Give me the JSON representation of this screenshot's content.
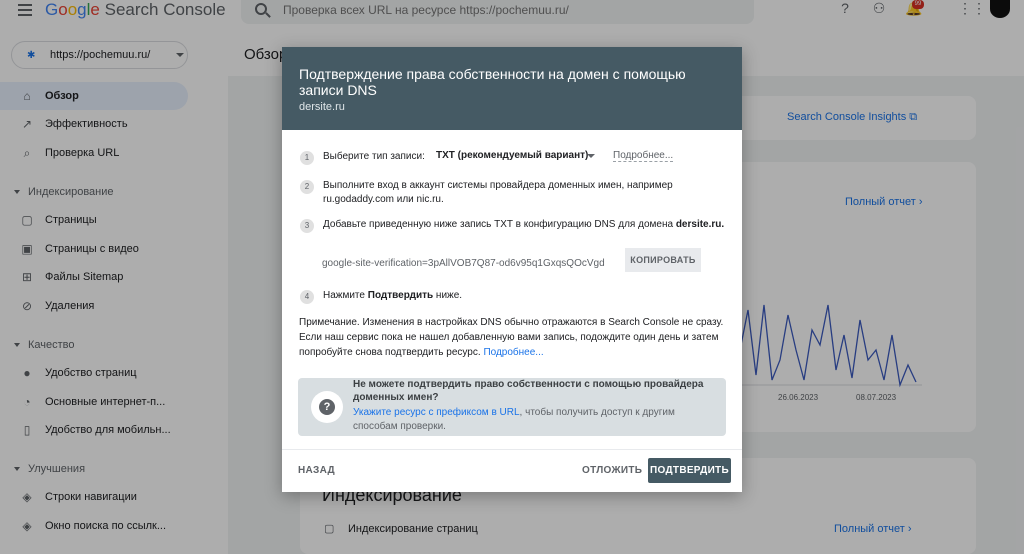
{
  "header": {
    "logo": "Google Search Console",
    "search_placeholder": "Проверка всех URL на ресурсе https://pochemuu.ru/",
    "notification_count": "99"
  },
  "sidebar": {
    "property": "https://pochemuu.ru/",
    "items": [
      {
        "label": "Обзор",
        "icon": "home-icon"
      },
      {
        "label": "Эффективность",
        "icon": "trend-icon"
      },
      {
        "label": "Проверка URL",
        "icon": "search-icon"
      }
    ],
    "indexing_label": "Индексирование",
    "indexing_items": [
      {
        "label": "Страницы",
        "icon": "pages-icon"
      },
      {
        "label": "Страницы с видео",
        "icon": "video-pages-icon"
      },
      {
        "label": "Файлы Sitemap",
        "icon": "sitemap-icon"
      },
      {
        "label": "Удаления",
        "icon": "removals-icon"
      }
    ],
    "quality_label": "Качество",
    "quality_items": [
      {
        "label": "Удобство страниц",
        "icon": "page-experience-icon"
      },
      {
        "label": "Основные интернет-п...",
        "icon": "core-vitals-icon"
      },
      {
        "label": "Удобство для мобильн...",
        "icon": "mobile-icon"
      }
    ],
    "enhancements_label": "Улучшения",
    "enhancements_items": [
      {
        "label": "Строки навигации",
        "icon": "breadcrumbs-icon"
      },
      {
        "label": "Окно поиска по ссылк...",
        "icon": "sitelinks-icon"
      }
    ]
  },
  "main": {
    "title": "Обзор",
    "insights_link": "Search Console Insights",
    "full_report_1": "Полный отчет",
    "chart_ticks": [
      "26.06.2023",
      "08.07.2023"
    ],
    "indexing_heading": "Индексирование",
    "indexing_row": "Индексирование страниц",
    "full_report_2": "Полный отчет"
  },
  "dialog": {
    "title": "Подтверждение права собственности на домен с помощью записи DNS",
    "domain": "dersite.ru",
    "step1_num": "1",
    "step1_label": "Выберите тип записи:",
    "record_type": "TXT (рекомендуемый вариант)",
    "more_link": "Подробнее...",
    "step2_num": "2",
    "step2_line1": "Выполните вход в аккаунт системы провайдера доменных имен, например",
    "step2_line2": "ru.godaddy.com или nic.ru.",
    "step3_num": "3",
    "step3_text": "Добавьте приведенную ниже запись TXT в конфигурацию DNS для домена",
    "step3_domain": "dersite.ru.",
    "record_value": "google-site-verification=3pAllVOB7Q87-od6v95q1GxqsQOcVgd",
    "copy_label": "КОПИРОВАТЬ",
    "step4_num": "4",
    "step4_pre": "Нажмите",
    "step4_bold": "Подтвердить",
    "step4_post": "ниже.",
    "note": "Примечание. Изменения в настройках DNS обычно отражаются в Search Console не сразу. Если наш сервис пока не нашел добавленную вами запись, подождите один день и затем попробуйте снова подтвердить ресурс.",
    "note_link": "Подробнее...",
    "help_title": "Не можете подтвердить право собственности с помощью провайдера доменных имен?",
    "help_link": "Укажите ресурс с префиксом в URL",
    "help_text": ", чтобы получить доступ к другим способам проверки.",
    "back_label": "НАЗАД",
    "later_label": "ОТЛОЖИТЬ",
    "confirm_label": "ПОДТВЕРДИТЬ"
  },
  "colors": {
    "dialog_header": "#455a64",
    "accent": "#1a73e8",
    "help_box": "#d8dee1",
    "chart_line": "#3c5bbf"
  }
}
